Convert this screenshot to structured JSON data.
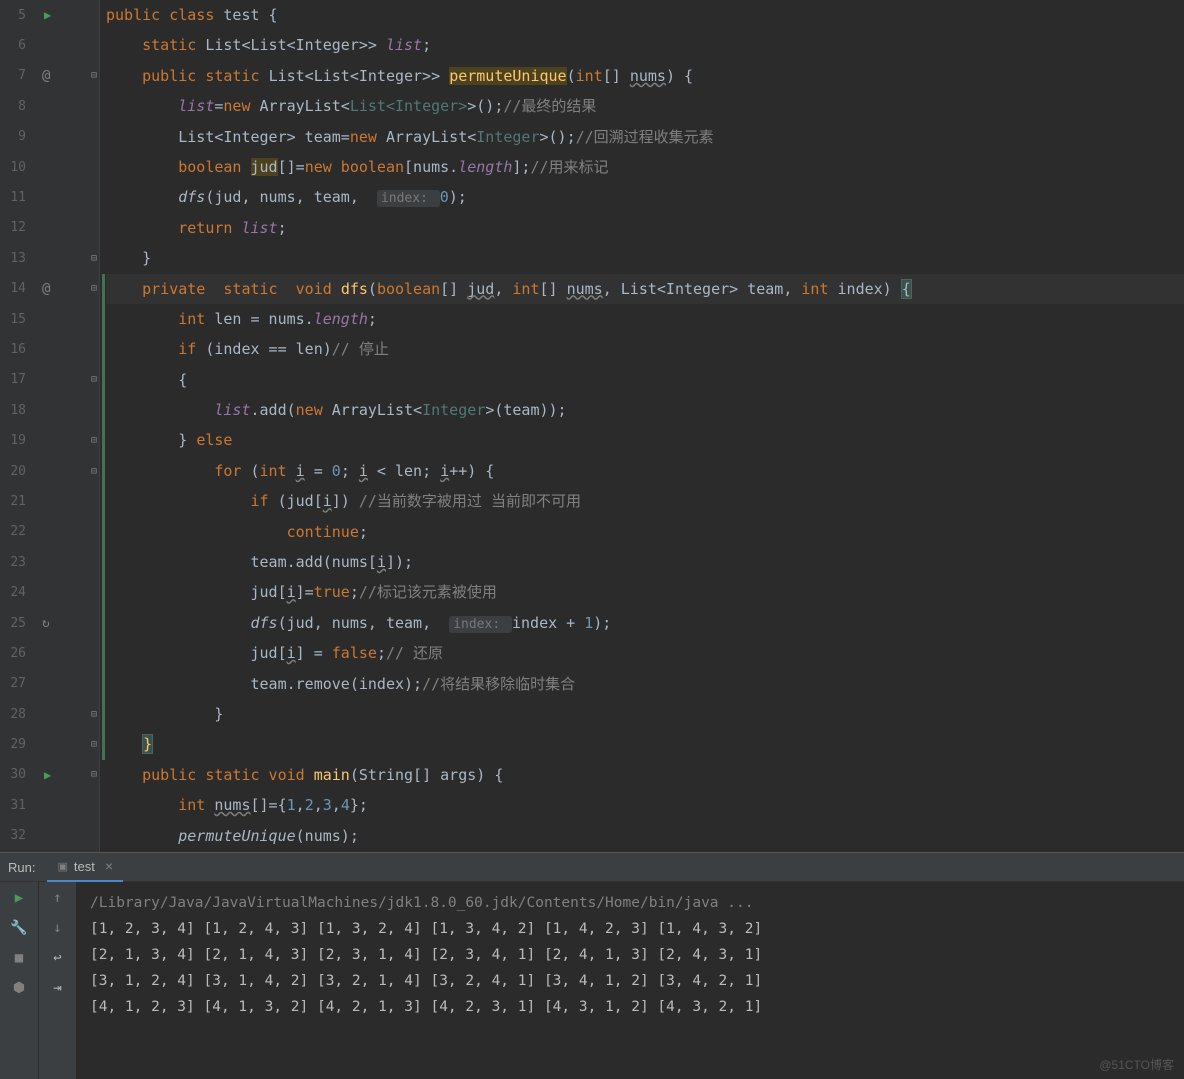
{
  "lines": [
    {
      "n": "5",
      "run": true
    },
    {
      "n": "6"
    },
    {
      "n": "7",
      "at": true,
      "fold": "open"
    },
    {
      "n": "8"
    },
    {
      "n": "9"
    },
    {
      "n": "10"
    },
    {
      "n": "11"
    },
    {
      "n": "12"
    },
    {
      "n": "13",
      "fold": "close"
    },
    {
      "n": "14",
      "at": true,
      "fold": "open"
    },
    {
      "n": "15"
    },
    {
      "n": "16"
    },
    {
      "n": "17",
      "fold": "open"
    },
    {
      "n": "18"
    },
    {
      "n": "19",
      "fold": "close"
    },
    {
      "n": "20",
      "fold": "open"
    },
    {
      "n": "21"
    },
    {
      "n": "22"
    },
    {
      "n": "23"
    },
    {
      "n": "24"
    },
    {
      "n": "25",
      "rec": true
    },
    {
      "n": "26"
    },
    {
      "n": "27"
    },
    {
      "n": "28",
      "fold": "close"
    },
    {
      "n": "29",
      "fold": "close"
    },
    {
      "n": "30",
      "run": true,
      "fold": "open"
    },
    {
      "n": "31"
    },
    {
      "n": "32"
    }
  ],
  "code": {
    "l5": {
      "pre": "",
      "a": "public class ",
      "b": "test {"
    },
    "l6": {
      "pre": "    ",
      "a": "static ",
      "b": "List<List<Integer>> ",
      "c": "list",
      ";": ";"
    },
    "l7": {
      "pre": "    ",
      "a": "public static ",
      "b": "List<List<Integer>> ",
      "fn": "permuteUnique",
      "c": "(",
      "d": "int",
      "e": "[] ",
      "f": "nums",
      "g": ") {"
    },
    "l8": {
      "pre": "        ",
      "a": "list",
      "b": "=",
      "c": "new ",
      "d": "ArrayList<",
      "e": "List<Integer>",
      "f": ">();",
      "cmt": "//最终的结果"
    },
    "l9": {
      "pre": "        ",
      "a": "List<Integer> team=",
      "b": "new ",
      "c": "ArrayList<",
      "d": "Integer",
      "e": ">();",
      "cmt": "//回溯过程收集元素"
    },
    "l10": {
      "pre": "        ",
      "a": "boolean ",
      "b": "jud",
      "c": "[]=",
      "d": "new boolean",
      "e": "[nums.",
      "f": "length",
      "g": "];",
      "cmt": "//用来标记"
    },
    "l11": {
      "pre": "        ",
      "a": "dfs",
      "b": "(jud, nums, team,  ",
      "hint": "index: ",
      "num": "0",
      "c": ");"
    },
    "l12": {
      "pre": "        ",
      "a": "return ",
      "b": "list",
      "c": ";"
    },
    "l13": {
      "pre": "    ",
      "a": "}"
    },
    "l14": {
      "pre": "    ",
      "a": "private  static  void ",
      "fn": "dfs",
      "b": "(",
      "c": "boolean",
      "d": "[] ",
      "e": "jud",
      "f": ", ",
      "g": "int",
      "h": "[] ",
      "i": "nums",
      "j": ", List<Integer> team, ",
      "k": "int ",
      "l": "index) ",
      "brace": "{"
    },
    "l15": {
      "pre": "        ",
      "a": "int ",
      "b": "len = nums.",
      "c": "length",
      "d": ";"
    },
    "l16": {
      "pre": "        ",
      "a": "if ",
      "b": "(index == len)",
      "cmt": "// 停止"
    },
    "l17": {
      "pre": "        ",
      "a": "{"
    },
    "l18": {
      "pre": "            ",
      "a": "list",
      "b": ".add(",
      "c": "new ",
      "d": "ArrayList<",
      "e": "Integer",
      "f": ">(team));"
    },
    "l19": {
      "pre": "        ",
      "a": "} ",
      "b": "else"
    },
    "l20": {
      "pre": "            ",
      "a": "for ",
      "b": "(",
      "c": "int ",
      "d": "i",
      "e": " = ",
      "n0": "0",
      "f": "; ",
      "g": "i",
      "h": " < len; ",
      "i": "i",
      "j": "++) {"
    },
    "l21": {
      "pre": "                ",
      "a": "if ",
      "b": "(jud[",
      "c": "i",
      "d": "]) ",
      "cmt": "//当前数字被用过 当前即不可用"
    },
    "l22": {
      "pre": "                    ",
      "a": "continue",
      ";": ";"
    },
    "l23": {
      "pre": "                ",
      "a": "team.add(nums[",
      "b": "i",
      "c": "]);"
    },
    "l24": {
      "pre": "                ",
      "a": "jud[",
      "b": "i",
      "c": "]=",
      "d": "true",
      ";": ";",
      "cmt": "//标记该元素被使用"
    },
    "l25": {
      "pre": "                ",
      "a": "dfs",
      "b": "(jud, nums, team,  ",
      "hint": "index: ",
      "c": "index + ",
      "num": "1",
      "d": ");"
    },
    "l26": {
      "pre": "                ",
      "a": "jud[",
      "b": "i",
      "c": "] = ",
      "d": "false",
      ";": ";",
      "cmt": "// 还原"
    },
    "l27": {
      "pre": "                ",
      "a": "team.remove(index);",
      "cmt": "//将结果移除临时集合"
    },
    "l28": {
      "pre": "            ",
      "a": "}"
    },
    "l29": {
      "pre": "    ",
      "brace": "}"
    },
    "l30": {
      "pre": "    ",
      "a": "public static void ",
      "fn": "main",
      "b": "(String[] args) {"
    },
    "l31": {
      "pre": "        ",
      "a": "int ",
      "b": "nums",
      "c": "[]={",
      "n1": "1",
      "d": ",",
      "n2": "2",
      "e": ",",
      "n3": "3",
      "f": ",",
      "n4": "4",
      "g": "};"
    },
    "l32": {
      "pre": "        ",
      "a": "permuteUnique",
      "b": "(nums);"
    }
  },
  "run": {
    "label": "Run:",
    "tab": "test",
    "console_first": "/Library/Java/JavaVirtualMachines/jdk1.8.0_60.jdk/Contents/Home/bin/java ...",
    "console_l1": "[1, 2, 3, 4] [1, 2, 4, 3] [1, 3, 2, 4] [1, 3, 4, 2] [1, 4, 2, 3] [1, 4, 3, 2]",
    "console_l2": "[2, 1, 3, 4] [2, 1, 4, 3] [2, 3, 1, 4] [2, 3, 4, 1] [2, 4, 1, 3] [2, 4, 3, 1]",
    "console_l3": "[3, 1, 2, 4] [3, 1, 4, 2] [3, 2, 1, 4] [3, 2, 4, 1] [3, 4, 1, 2] [3, 4, 2, 1]",
    "console_l4": "[4, 1, 2, 3] [4, 1, 3, 2] [4, 2, 1, 3] [4, 2, 3, 1] [4, 3, 1, 2] [4, 3, 2, 1]"
  },
  "watermark": "@51CTO博客"
}
